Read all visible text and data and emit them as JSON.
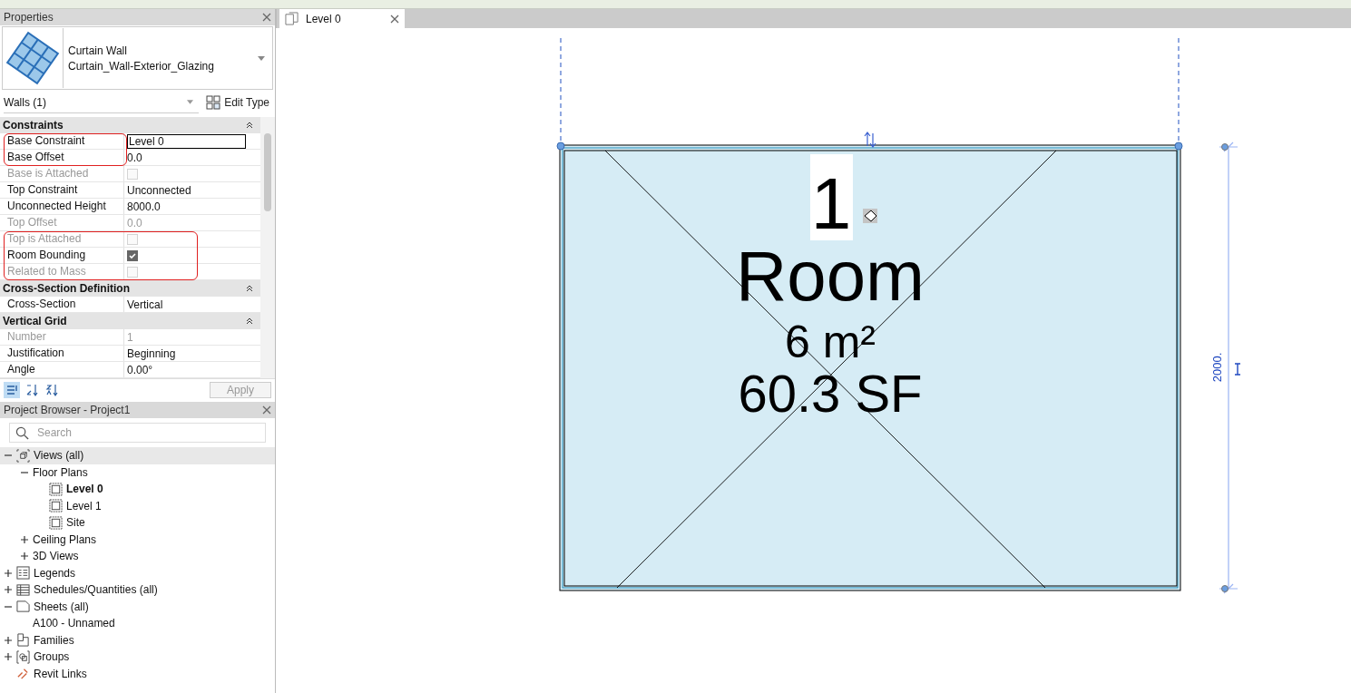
{
  "properties": {
    "title": "Properties",
    "type_family": "Curtain Wall",
    "type_name": "Curtain_Wall-Exterior_Glazing",
    "instance_filter": "Walls (1)",
    "edit_type": "Edit Type",
    "groups": [
      {
        "title": "Constraints",
        "rows": [
          {
            "label": "Base Constraint",
            "value": "Level 0",
            "kind": "text",
            "disabled": false,
            "editing": true,
            "circled": true
          },
          {
            "label": "Base Offset",
            "value": "0.0",
            "kind": "text",
            "disabled": false,
            "editing": false,
            "circled": true
          },
          {
            "label": "Base is Attached",
            "kind": "check",
            "checked": false,
            "disabled": true,
            "circled": false
          },
          {
            "label": "Top Constraint",
            "value": "Unconnected",
            "kind": "text",
            "disabled": false,
            "editing": false,
            "circled": false
          },
          {
            "label": "Unconnected Height",
            "value": "8000.0",
            "kind": "text",
            "disabled": false,
            "editing": false,
            "circled": false
          },
          {
            "label": "Top Offset",
            "value": "0.0",
            "kind": "text",
            "disabled": true,
            "editing": false,
            "circled": false
          },
          {
            "label": "Top is Attached",
            "kind": "check",
            "checked": false,
            "disabled": true,
            "circled": true
          },
          {
            "label": "Room Bounding",
            "kind": "check",
            "checked": true,
            "disabled": false,
            "circled": true
          },
          {
            "label": "Related to Mass",
            "kind": "check",
            "checked": false,
            "disabled": true,
            "circled": true
          }
        ]
      },
      {
        "title": "Cross-Section Definition",
        "rows": [
          {
            "label": "Cross-Section",
            "value": "Vertical",
            "kind": "text",
            "disabled": false,
            "editing": false,
            "circled": false
          }
        ]
      },
      {
        "title": "Vertical Grid",
        "rows": [
          {
            "label": "Number",
            "value": "1",
            "kind": "text",
            "disabled": true,
            "editing": false,
            "circled": false
          },
          {
            "label": "Justification",
            "value": "Beginning",
            "kind": "text",
            "disabled": false,
            "editing": false,
            "circled": false
          },
          {
            "label": "Angle",
            "value": "0.00°",
            "kind": "text",
            "disabled": false,
            "editing": false,
            "circled": false
          }
        ]
      }
    ],
    "apply": "Apply"
  },
  "project_browser": {
    "title": "Project Browser - Project1",
    "search": {
      "placeholder": "Search"
    },
    "tree": [
      {
        "label": "Views (all)",
        "kind": "views",
        "expanded": true,
        "selected": true,
        "current": false,
        "children": [
          {
            "label": "Floor Plans",
            "expanded": true,
            "selected": false,
            "current": false,
            "children": [
              {
                "label": "Level 0",
                "kind": "plan",
                "selected": false,
                "current": true
              },
              {
                "label": "Level 1",
                "kind": "plan",
                "selected": false,
                "current": false
              },
              {
                "label": "Site",
                "kind": "plan",
                "selected": false,
                "current": false
              }
            ]
          },
          {
            "label": "Ceiling Plans",
            "expanded": false,
            "selected": false,
            "current": false
          },
          {
            "label": "3D Views",
            "expanded": false,
            "selected": false,
            "current": false
          }
        ]
      },
      {
        "label": "Legends",
        "kind": "legend",
        "expanded": false,
        "selected": false,
        "current": false
      },
      {
        "label": "Schedules/Quantities (all)",
        "kind": "schedule",
        "expanded": false,
        "selected": false,
        "current": false
      },
      {
        "label": "Sheets (all)",
        "kind": "sheet",
        "expanded": true,
        "selected": false,
        "current": false,
        "children": [
          {
            "label": "A100 - Unnamed",
            "selected": false,
            "current": false
          }
        ]
      },
      {
        "label": "Families",
        "kind": "family",
        "expanded": false,
        "selected": false,
        "current": false
      },
      {
        "label": "Groups",
        "kind": "group",
        "expanded": false,
        "selected": false,
        "current": false
      },
      {
        "label": "Revit Links",
        "kind": "link",
        "selected": false,
        "current": false
      }
    ]
  },
  "view_tab": {
    "label": "Level 0"
  },
  "room_tag": {
    "number": "1",
    "name": "Room",
    "area_metric": "6 m²",
    "area_imperial": "60.3 SF"
  },
  "dimension": {
    "value": "2000."
  }
}
